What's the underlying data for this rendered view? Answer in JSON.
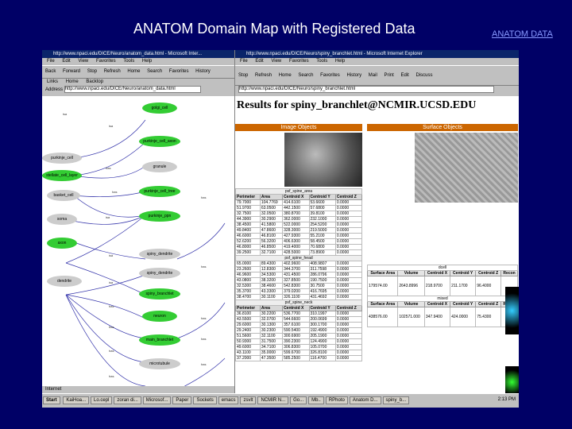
{
  "slide_title": "ANATOM Domain Map with Registered Data",
  "corner_link": "ANATOM DATA",
  "left_window": {
    "title": "http://www.npaci.edu/DICE/Neuro/anatom_data.html - Microsoft Inter...",
    "menu": [
      "File",
      "Edit",
      "View",
      "Favorites",
      "Tools",
      "Help"
    ],
    "toolbar": [
      "Back",
      "Forward",
      "Stop",
      "Refresh",
      "Home",
      "Search",
      "Favorites",
      "History"
    ],
    "toolbar2": [
      "Links",
      "Home",
      "Backtop"
    ],
    "address_label": "Address",
    "address_value": "http://www.npaci.edu/DICE/Neuro/anatom_data.html",
    "status": "Internet",
    "nodes": [
      {
        "label": "golgi_cell",
        "color": "green"
      },
      {
        "label": "purkinje_cell",
        "color": "grey"
      },
      {
        "label": "stellate_cell_layer",
        "color": "green"
      },
      {
        "label": "basket_cell",
        "color": "grey"
      },
      {
        "label": "soma",
        "color": "grey"
      },
      {
        "label": "axon",
        "color": "green"
      },
      {
        "label": "dendrite",
        "color": "grey"
      },
      {
        "label": "purkinje_cell_axon",
        "color": "green"
      },
      {
        "label": "granule",
        "color": "grey"
      },
      {
        "label": "purkinje_cell_tree",
        "color": "green"
      },
      {
        "label": "purkinje_ppn",
        "color": "green"
      },
      {
        "label": "spiny_dendrite",
        "color": "grey"
      },
      {
        "label": "spiny_dendrite",
        "color": "grey"
      },
      {
        "label": "spiny_branchlet",
        "color": "green"
      },
      {
        "label": "neuron",
        "color": "green"
      },
      {
        "label": "main_branchlet",
        "color": "green"
      },
      {
        "label": "microtubule",
        "color": "grey"
      }
    ],
    "edge_labels": [
      "isa",
      "has",
      "isa",
      "has",
      "isa",
      "has",
      "has",
      "has",
      "isa",
      "has",
      "isa",
      "has",
      "has",
      "has",
      "has",
      "has"
    ]
  },
  "right_window": {
    "title": "http://www.npaci.edu/DICE/Neuro/spiny_branchlet.html - Microsoft Internet Explorer",
    "menu": [
      "File",
      "Edit",
      "View",
      "Favorites",
      "Tools",
      "Help"
    ],
    "toolbar": [
      "Stop",
      "Refresh",
      "Home",
      "Search",
      "Favorites",
      "History",
      "Mail",
      "Print",
      "Edit",
      "Discuss"
    ],
    "address_value": "http://www.npaci.edu/DICE/Neuro/spiny_branchlet.html",
    "results_title": "Results for spiny_branchlet@NCMIR.UCSD.EDU",
    "image_objects_label": "Image Objects",
    "surface_objects_label": "Surface Objects",
    "image_table": {
      "caption1": "psf_spine_area",
      "headers": [
        "Perimeter",
        "Area",
        "Centroid X",
        "Centroid Y",
        "Centroid Z"
      ],
      "rows1": [
        [
          "79.7000",
          "104.7769",
          "414.6100",
          "53.6600",
          "0.0000"
        ],
        [
          "51.9700",
          "63.0500",
          "442.1500",
          "57.6800",
          "0.0000"
        ],
        [
          "32.7500",
          "32.0500",
          "380.8700",
          "39.8100",
          "0.0000"
        ],
        [
          "44.3900",
          "30.2900",
          "362.0000",
          "232.1000",
          "0.0000"
        ],
        [
          "38.4500",
          "41.5800",
          "522.0000",
          "254.5200",
          "0.0000"
        ],
        [
          "49.8400",
          "47.8600",
          "328.3000",
          "219.5000",
          "0.0000"
        ],
        [
          "46.6000",
          "46.8100",
          "427.9300",
          "55.2100",
          "0.0000"
        ],
        [
          "52.6200",
          "56.3200",
          "406.6300",
          "58.4500",
          "0.0000"
        ],
        [
          "46.8000",
          "46.8500",
          "419.4000",
          "70.6800",
          "0.0000"
        ],
        [
          "39.2500",
          "32.7100",
          "428.5000",
          "73.8900",
          "0.0000"
        ]
      ],
      "caption2": "psf_spine_head",
      "rows2": [
        [
          "65.0000",
          "89.4300",
          "402.9600",
          "408.9807",
          "0.0000"
        ],
        [
          "23.2600",
          "12.8300",
          "344.3700",
          "311.7598",
          "0.0000"
        ],
        [
          "46.9600",
          "34.5300",
          "431.4500",
          "286.0796",
          "0.0000"
        ],
        [
          "43.0800",
          "38.3200",
          "327.8500",
          "190.7500",
          "0.0000"
        ],
        [
          "32.5300",
          "38.4600",
          "542.8300",
          "30.7500",
          "0.0000"
        ],
        [
          "35.3700",
          "43.3300",
          "379.0200",
          "416.7695",
          "0.0000"
        ],
        [
          "38.4700",
          "30.1100",
          "326.1100",
          "431.4692",
          "0.0000"
        ]
      ],
      "caption3": "psf_spine_neck",
      "rows3": [
        [
          "36.8100",
          "30.2200",
          "536.7700",
          "310.1997",
          "0.0000"
        ],
        [
          "43.5500",
          "32.0700",
          "544.6600",
          "200.0699",
          "0.0000"
        ],
        [
          "29.6000",
          "30.1300",
          "357.6100",
          "300.1700",
          "0.0000"
        ],
        [
          "29.2400",
          "30.2300",
          "590.5400",
          "192.4900",
          "0.0000"
        ],
        [
          "51.5600",
          "32.1100",
          "300.6900",
          "205.1900",
          "0.0000"
        ],
        [
          "50.9300",
          "31.7500",
          "390.2300",
          "124.4900",
          "0.0000"
        ],
        [
          "49.6000",
          "34.7100",
          "306.8300",
          "105.0700",
          "0.0000"
        ],
        [
          "43.1100",
          "35.0000",
          "599.6700",
          "326.8100",
          "0.0000"
        ],
        [
          "37.2000",
          "47.3500",
          "585.2500",
          "116.4700",
          "0.0000"
        ]
      ]
    },
    "surface_table": {
      "headers": [
        "Surface Area",
        "Volume",
        "Centroid X",
        "Centroid Y",
        "Centroid Z",
        "Recon"
      ],
      "rows": [
        [
          "179574.00",
          "2643.8996",
          "218.9700",
          "211.1700",
          "96.4000",
          ""
        ],
        [
          "438576.00",
          "102571.000",
          "347.9400",
          "424.0000",
          "75.4300",
          ""
        ]
      ],
      "caption1": "dcell",
      "caption2": "mixed"
    }
  },
  "taskbar": {
    "start": "Start",
    "items": [
      "KaiHoa...",
      "Lo.cepl",
      "zoran di...",
      "Microsof...",
      "Paper",
      "Sockets",
      "emacs",
      "zsvlt",
      "NCMIR N...",
      "Go...",
      "Mb..",
      "RPhoto",
      "Anatom D...",
      "spiny_b..."
    ],
    "clock": "2:13 PM"
  }
}
